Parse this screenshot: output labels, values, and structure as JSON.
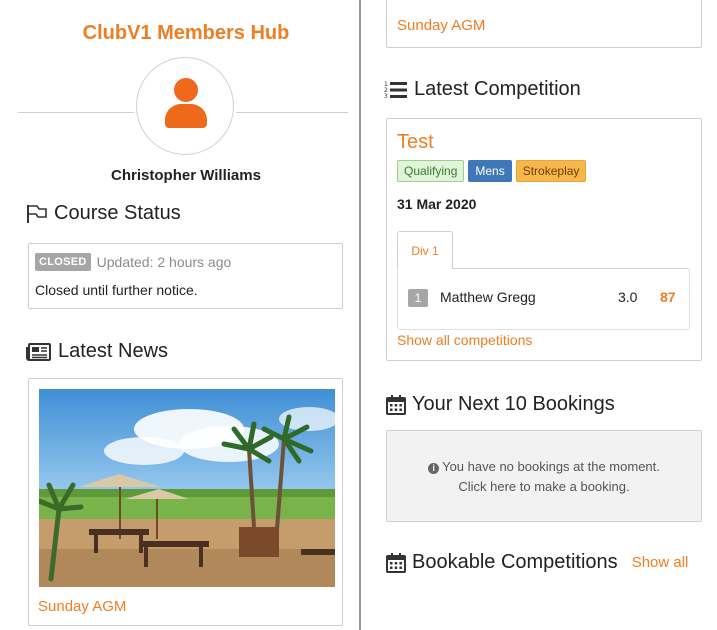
{
  "hub": {
    "title": "ClubV1 Members Hub",
    "member_name": "Christopher Williams"
  },
  "course_status": {
    "heading": "Course Status",
    "badge": "CLOSED",
    "updated": "Updated: 2 hours ago",
    "note": "Closed until further notice."
  },
  "latest_news": {
    "heading": "Latest News",
    "article_title": "Sunday AGM"
  },
  "news_top_card": {
    "article_title": "Sunday AGM"
  },
  "latest_competition": {
    "heading": "Latest Competition",
    "title": "Test",
    "tags": [
      "Qualifying",
      "Mens",
      "Strokeplay"
    ],
    "date": "31 Mar 2020",
    "division_tab": "Div 1",
    "leaderboard": [
      {
        "rank": "1",
        "name": "Matthew Gregg",
        "handicap": "3.0",
        "score": "87"
      }
    ],
    "show_all": "Show all competitions"
  },
  "bookings": {
    "heading": "Your Next 10 Bookings",
    "empty_line1": "You have no bookings at the moment.",
    "empty_line2": "Click here to make a booking."
  },
  "bookable_competitions": {
    "heading": "Bookable Competitions",
    "show_all": "Show all"
  },
  "colors": {
    "accent": "#ef7d22",
    "avatar": "#ee6a1a",
    "divider": "#9a9a9a",
    "tag_qualifying": "#dff4da",
    "tag_mens": "#3f78b8",
    "tag_strokeplay": "#f7b84b"
  },
  "icons": {
    "course_status": "flag-outline-icon",
    "latest_news": "newspaper-icon",
    "latest_competition": "ordered-list-icon",
    "bookings": "calendar-icon",
    "bookable": "calendar-icon",
    "avatar": "user-icon",
    "info": "info-circle-icon"
  }
}
